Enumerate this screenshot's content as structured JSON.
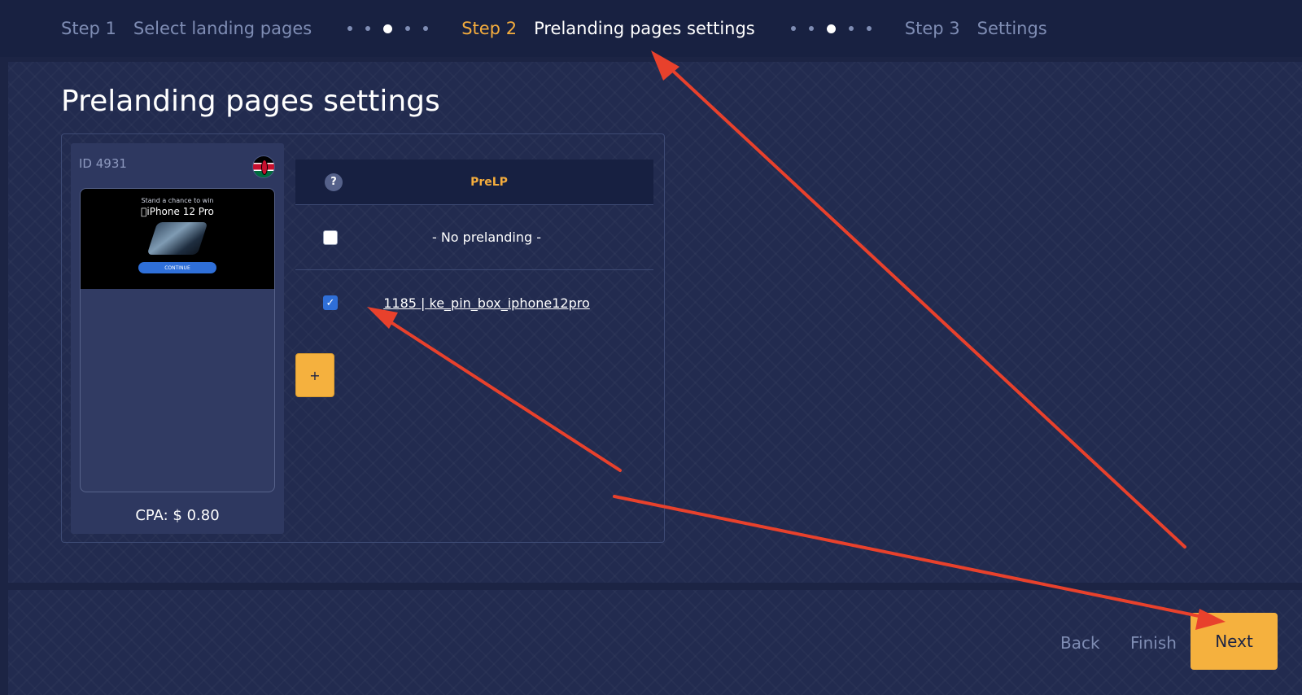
{
  "stepper": {
    "steps": [
      {
        "number": "Step 1",
        "title": "Select landing pages"
      },
      {
        "number": "Step 2",
        "title": "Prelanding pages settings"
      },
      {
        "number": "Step 3",
        "title": "Settings"
      }
    ]
  },
  "page": {
    "heading": "Prelanding pages settings"
  },
  "landing_card": {
    "id_label": "ID 4931",
    "flag": "kenya-flag-icon",
    "preview": {
      "small_text": "Stand a chance to win",
      "title": "iPhone 12 Pro",
      "button": "CONTINUE"
    },
    "cpa": "CPA: $ 0.80"
  },
  "prelanding_table": {
    "help_label": "?",
    "header": "PreLP",
    "rows": [
      {
        "label": "- No prelanding -",
        "checked": false
      },
      {
        "label": "1185 | ke_pin_box_iphone12pro",
        "checked": true
      }
    ],
    "add_label": "+"
  },
  "footer": {
    "back_label": "Back",
    "finish_label": "Finish",
    "next_label": "Next"
  },
  "colors": {
    "accent": "#f5ad3d",
    "background": "#1c2444",
    "checkbox": "#2f6fd8",
    "arrow": "#e8412c"
  }
}
